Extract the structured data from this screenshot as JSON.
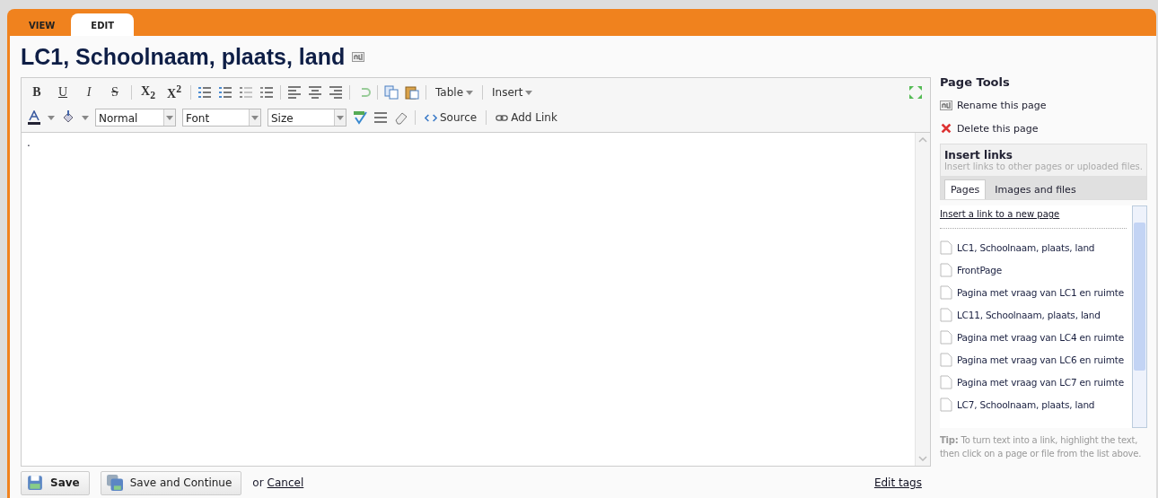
{
  "tabs": [
    {
      "label": "VIEW",
      "selected": false
    },
    {
      "label": "EDIT",
      "selected": true
    }
  ],
  "title": "LC1, Schoolnaam, plaats, land",
  "toolbar": {
    "format_buttons": [
      "B",
      "U",
      "I",
      "S",
      "X$_{2}$",
      "X$^{2}$"
    ],
    "table_menu": "Table",
    "insert_menu": "Insert",
    "selects": [
      {
        "kind": "format",
        "value": "Normal"
      },
      {
        "kind": "font",
        "value": "Font"
      },
      {
        "kind": "size",
        "value": "Size"
      }
    ],
    "source_button": "Source",
    "add_link_button": "Add Link"
  },
  "editor": {
    "content": "."
  },
  "footer": {
    "save": "Save",
    "save_continue": "Save and Continue",
    "or": "or",
    "cancel": "Cancel",
    "edit_tags": "Edit tags"
  },
  "sidebar": {
    "title": "Page Tools",
    "rename": "Rename this page",
    "delete": "Delete this page",
    "insert_links": {
      "title": "Insert links",
      "subtitle": "Insert links to other pages or uploaded files.",
      "tabs": [
        {
          "label": "Pages",
          "selected": true
        },
        {
          "label": "Images and files",
          "selected": false
        }
      ],
      "new_page_link": "Insert a link to a new page",
      "pages": [
        "LC1, Schoolnaam, plaats, land",
        "FrontPage",
        "Pagina met vraag van LC1 en ruimte",
        "LC11, Schoolnaam, plaats, land",
        "Pagina met vraag van LC4 en ruimte",
        "Pagina met vraag van LC6 en ruimte",
        "Pagina met vraag van LC7 en ruimte",
        "LC7, Schoolnaam, plaats, land"
      ]
    },
    "tip_label": "Tip:",
    "tip": "To turn text into a link, highlight the text, then click on a page or file from the list above."
  }
}
